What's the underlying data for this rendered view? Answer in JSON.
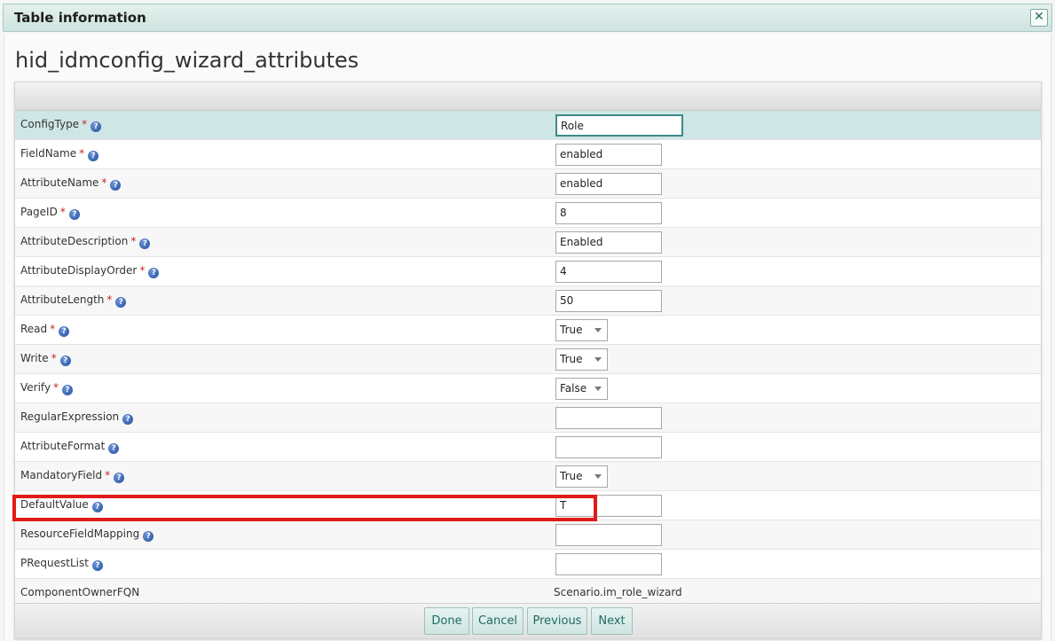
{
  "dialog": {
    "title": "Table information",
    "close_icon": "close-icon"
  },
  "page": {
    "heading": "hid_idmconfig_wizard_attributes"
  },
  "rows": [
    {
      "label": "ConfigType",
      "required": "*",
      "type": "input",
      "value": "Role"
    },
    {
      "label": "FieldName",
      "required": "*",
      "type": "input",
      "value": "enabled"
    },
    {
      "label": "AttributeName",
      "required": "*",
      "type": "input",
      "value": "enabled"
    },
    {
      "label": "PageID",
      "required": "*",
      "type": "input",
      "value": "8"
    },
    {
      "label": "AttributeDescription",
      "required": "*",
      "type": "input",
      "value": "Enabled"
    },
    {
      "label": "AttributeDisplayOrder",
      "required": "*",
      "type": "input",
      "value": "4"
    },
    {
      "label": "AttributeLength",
      "required": "*",
      "type": "input",
      "value": "50"
    },
    {
      "label": "Read",
      "required": "*",
      "type": "select",
      "value": "True"
    },
    {
      "label": "Write",
      "required": "*",
      "type": "select",
      "value": "True"
    },
    {
      "label": "Verify",
      "required": "*",
      "type": "select",
      "value": "False"
    },
    {
      "label": "RegularExpression",
      "required": "",
      "type": "input",
      "value": ""
    },
    {
      "label": "AttributeFormat",
      "required": "",
      "type": "input",
      "value": ""
    },
    {
      "label": "MandatoryField",
      "required": "*",
      "type": "select",
      "value": "True"
    },
    {
      "label": "DefaultValue",
      "required": "",
      "type": "input",
      "value": "T"
    },
    {
      "label": "ResourceFieldMapping",
      "required": "",
      "type": "input",
      "value": ""
    },
    {
      "label": "PRequestList",
      "required": "",
      "type": "input",
      "value": ""
    },
    {
      "label": "ComponentOwnerFQN",
      "required": "",
      "type": "static",
      "value": "Scenario.im_role_wizard"
    }
  ],
  "help_icon": "help-icon",
  "buttons": {
    "done": "Done",
    "cancel": "Cancel",
    "previous": "Previous",
    "next": "Next"
  },
  "colors": {
    "accent": "#1f6b63",
    "selected_row": "#cfe6e6",
    "highlight_box": "#e11a1a",
    "required_marker": "#c0272d"
  }
}
